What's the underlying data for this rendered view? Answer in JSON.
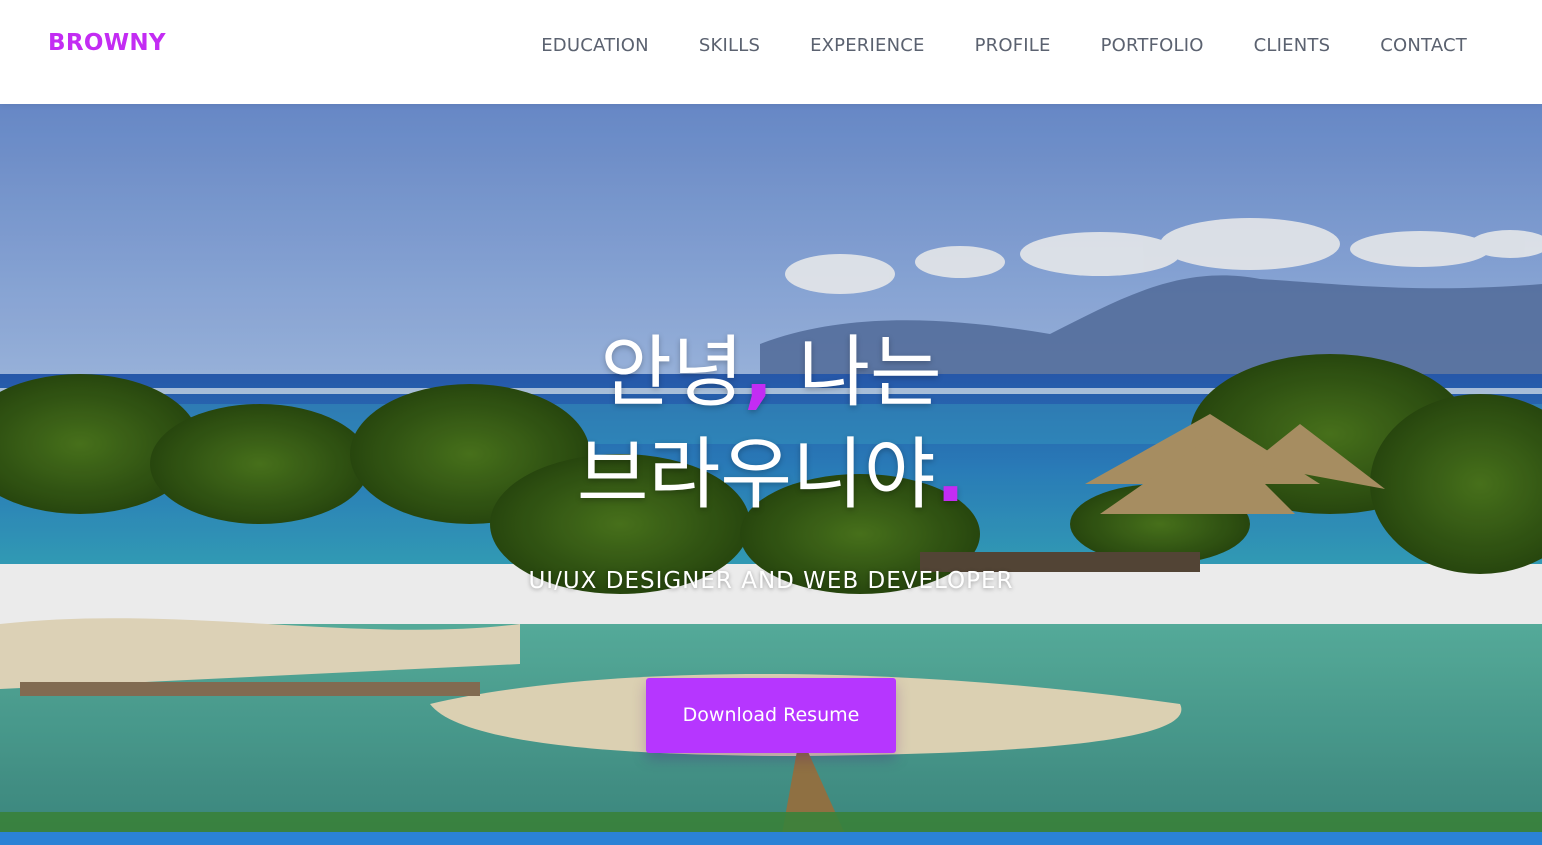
{
  "brand": {
    "name": "BROWNY"
  },
  "nav": {
    "items": [
      {
        "label": "EDUCATION"
      },
      {
        "label": "SKILLS"
      },
      {
        "label": "EXPERIENCE"
      },
      {
        "label": "PROFILE"
      },
      {
        "label": "PORTFOLIO"
      },
      {
        "label": "CLIENTS"
      },
      {
        "label": "CONTACT"
      }
    ]
  },
  "hero": {
    "greeting_line1_a": "안녕",
    "greeting_comma": ",",
    "greeting_line1_b": " 나는",
    "greeting_line2": "브라우니야",
    "greeting_dot": ".",
    "subtitle": "UI/UX DESIGNER AND WEB DEVELOPER",
    "button_label": "Download Resume"
  },
  "colors": {
    "accent": "#c32cf3",
    "button": "#b636ff",
    "nav_text": "#5b6270"
  }
}
